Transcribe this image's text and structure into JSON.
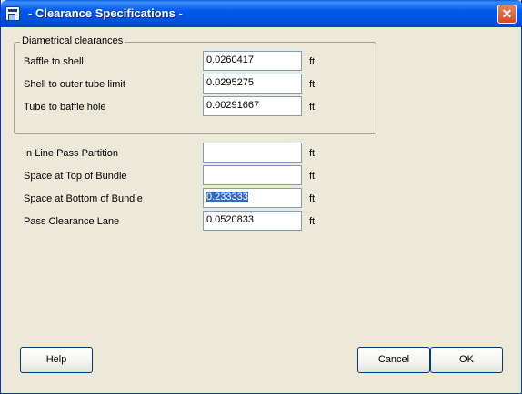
{
  "window": {
    "title": "- Clearance Specifications -",
    "close_glyph": "✕"
  },
  "diametrical": {
    "label": "Diametrical clearances",
    "fields": [
      {
        "label": "Baffle to shell",
        "value": "0.0260417",
        "unit": "ft"
      },
      {
        "label": "Shell to outer tube limit",
        "value": "0.0295275",
        "unit": "ft"
      },
      {
        "label": "Tube to baffle hole",
        "value": "0.00291667",
        "unit": "ft"
      }
    ]
  },
  "other": {
    "fields": [
      {
        "label": "In Line Pass Partition",
        "value": "",
        "unit": "ft"
      },
      {
        "label": "Space at Top of Bundle",
        "value": "",
        "unit": "ft"
      },
      {
        "label": "Space at Bottom of Bundle",
        "value": "0.233333",
        "unit": "ft",
        "selected": true
      },
      {
        "label": "Pass Clearance Lane",
        "value": "0.0520833",
        "unit": "ft"
      }
    ]
  },
  "buttons": {
    "help": "Help",
    "cancel": "Cancel",
    "ok": "OK"
  },
  "colors": {
    "titlebar": "#0054e3",
    "dialog_bg": "#ece9d8",
    "selection": "#316ac5",
    "close": "#d34a22"
  },
  "icons": {
    "app": "app-window-icon",
    "close": "close-icon"
  }
}
